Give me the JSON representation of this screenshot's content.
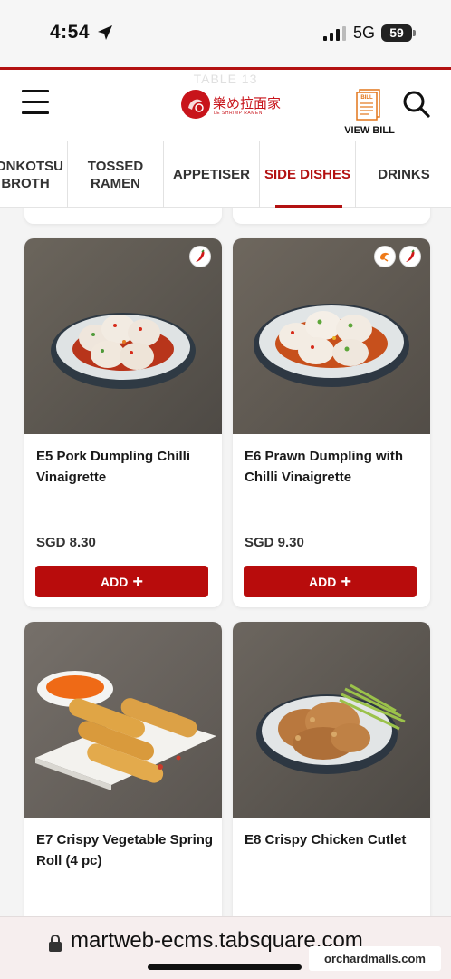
{
  "status_bar": {
    "time": "4:54",
    "network": "5G",
    "battery": "59"
  },
  "header": {
    "table_label": "TABLE 13",
    "logo_text": "樂め拉面家",
    "logo_subtext": "LE SHRIMP RAMEN",
    "view_bill_label": "VIEW BILL",
    "bill_icon_text": "BILL"
  },
  "tabs": [
    {
      "label": "TONKOTSU\nBROTH"
    },
    {
      "label": "TOSSED\nRAMEN"
    },
    {
      "label": "APPETISER"
    },
    {
      "label": "SIDE DISHES"
    },
    {
      "label": "DRINKS"
    }
  ],
  "active_tab": "SIDE DISHES",
  "menu_items": [
    {
      "name": "E5 Pork Dumpling Chilli Vinaigrette",
      "price": "SGD 8.30",
      "add_label": "ADD",
      "badges": [
        "chilli-icon"
      ]
    },
    {
      "name": "E6 Prawn Dumpling with Chilli Vinaigrette",
      "price": "SGD 9.30",
      "add_label": "ADD",
      "badges": [
        "prawn-icon",
        "chilli-icon"
      ]
    },
    {
      "name": "E7 Crispy Vegetable Spring Roll (4 pc)",
      "price": "",
      "add_label": "",
      "badges": []
    },
    {
      "name": "E8 Crispy Chicken Cutlet",
      "price": "",
      "add_label": "",
      "badges": []
    }
  ],
  "browser": {
    "url": "martweb-ecms.tabsquare.com"
  },
  "watermark": "orchardmalls.com",
  "colors": {
    "brand_red": "#b80c0c",
    "accent_red": "#b31111",
    "background": "#f4f4f4"
  }
}
